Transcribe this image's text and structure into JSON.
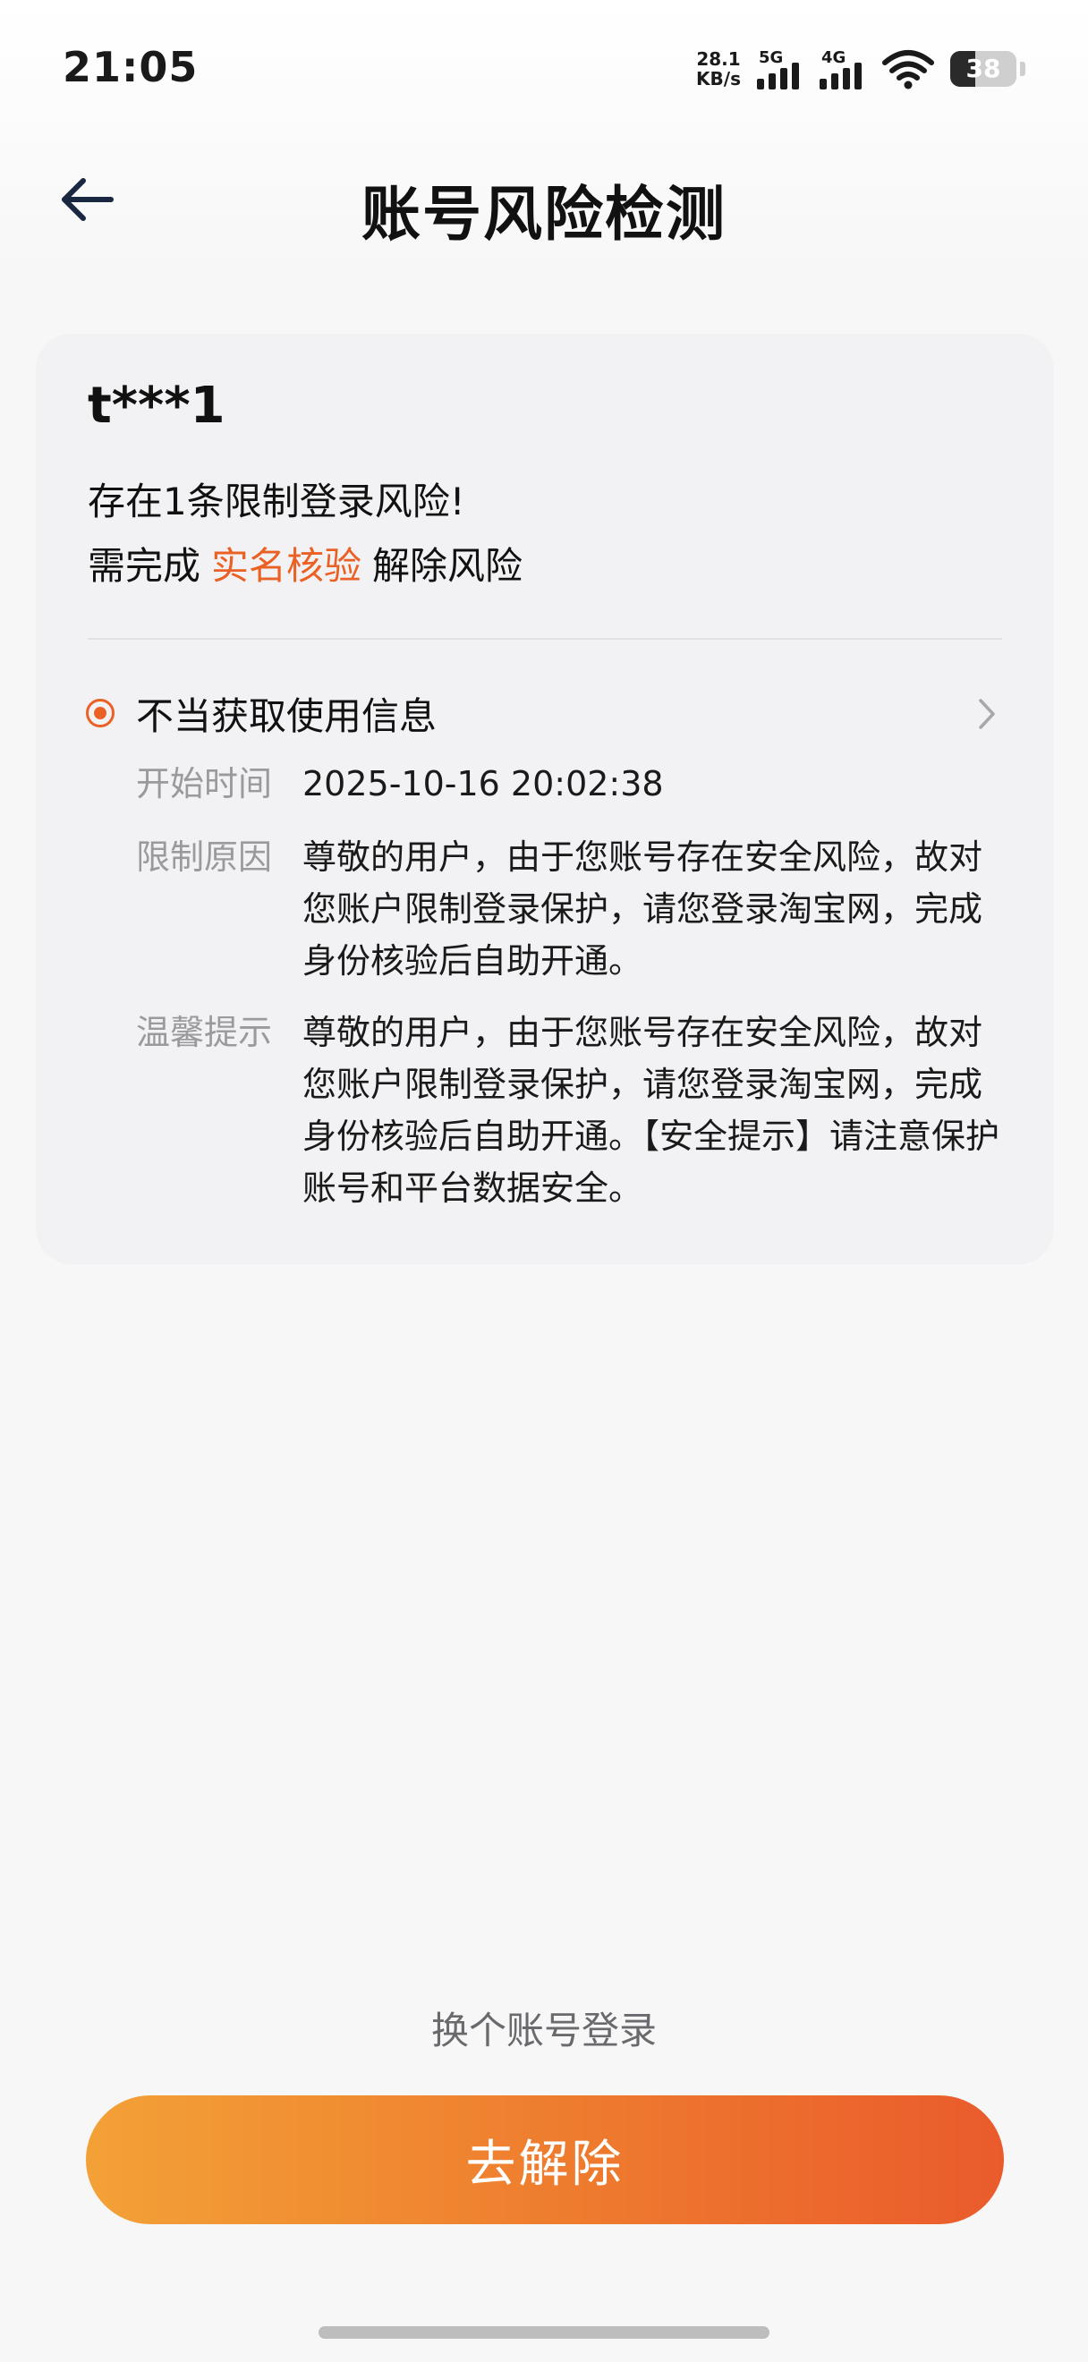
{
  "status_bar": {
    "time": "21:05",
    "net_speed_value": "28.1",
    "net_speed_unit": "KB/s",
    "sim1_tag": "5G",
    "sim2_tag": "4G",
    "battery_level": "38",
    "icons": [
      "signal-5g-icon",
      "signal-4g-icon",
      "wifi-icon",
      "battery-icon"
    ]
  },
  "header": {
    "title": "账号风险检测",
    "back_icon": "arrow-left-icon"
  },
  "card": {
    "account": "t***1",
    "risk_summary": "存在1条限制登录风险!",
    "action_prefix": "需完成",
    "action_link": "实名核验",
    "action_suffix": "解除风险",
    "risk_item": {
      "title": "不当获取使用信息",
      "dot_color": "#ea6126",
      "chevron_icon": "chevron-right-icon",
      "details": [
        {
          "label": "开始时间",
          "value": "2025-10-16 20:02:38"
        },
        {
          "label": "限制原因",
          "value": "尊敬的用户，由于您账号存在安全风险，故对您账户限制登录保护，请您登录淘宝网，完成身份核验后自助开通。"
        },
        {
          "label": "温馨提示",
          "value": "尊敬的用户，由于您账号存在安全风险，故对您账户限制登录保护，请您登录淘宝网，完成身份核验后自助开通。【安全提示】请注意保护账号和平台数据安全。"
        }
      ]
    }
  },
  "footer": {
    "switch_account": "换个账号登录",
    "primary_button": "去解除"
  },
  "colors": {
    "accent": "#ea6126",
    "button_gradient_start": "#f3a137",
    "button_gradient_end": "#ea5b2c"
  }
}
